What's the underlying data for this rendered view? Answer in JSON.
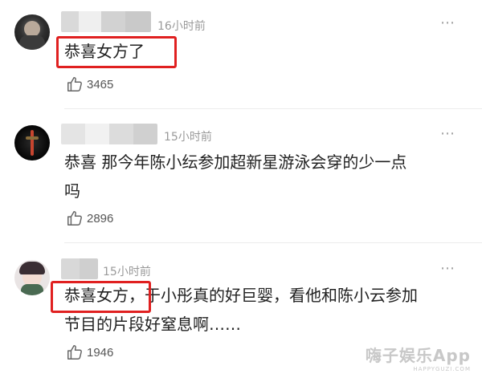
{
  "comments": [
    {
      "time": "16小时前",
      "lines": [
        "恭喜女方了"
      ],
      "likes": "3465",
      "highlight": "恭喜女方了"
    },
    {
      "time": "15小时前",
      "lines": [
        "恭喜 那今年陈小纭参加超新星游泳会穿的少一点",
        "吗"
      ],
      "likes": "2896"
    },
    {
      "time": "15小时前",
      "lines": [
        "恭喜女方，于小彤真的好巨婴，看他和陈小云参加",
        "节目的片段好窒息啊……"
      ],
      "likes": "1946",
      "highlight": "恭喜女方，"
    }
  ],
  "more_icon": "⋯",
  "like_icon": "thumbs-up-icon",
  "highlight_color": "#e02020",
  "watermark": {
    "main": "嗨子娱乐App",
    "sub": "HAPPYGUZI.COM"
  }
}
